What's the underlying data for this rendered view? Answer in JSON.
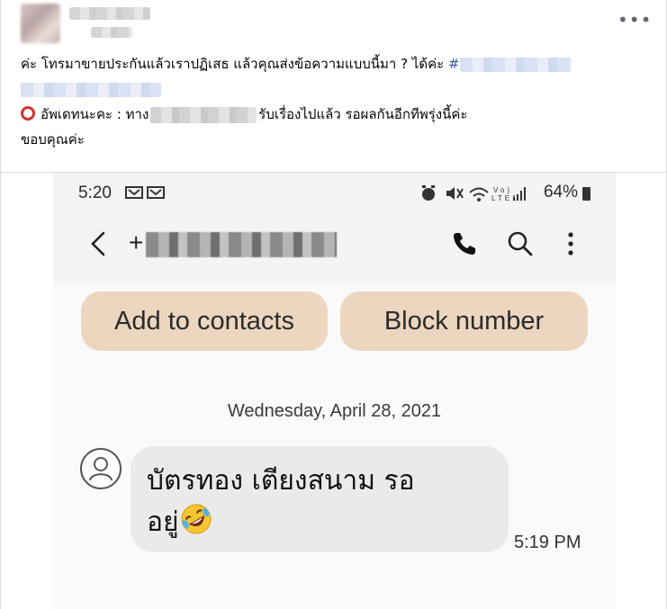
{
  "post": {
    "line1_text": "ค่ะ โทรมาขายประกันแล้วเราปฏิเสธ แล้วคุณส่งข้อความแบบนี้มา ? ได้ค่ะ ",
    "hashtag_prefix": "#",
    "line3_a": "อัพเดทนะคะ : ทาง",
    "line3_b": "รับเรื่องไปแล้ว รอผลกันอีกทีพรุ่งนี้ค่ะ",
    "line4": "ขอบคุณค่ะ",
    "more_label": "•••"
  },
  "phone": {
    "status": {
      "time": "5:20",
      "battery": "64%"
    },
    "contact": {
      "number_prefix": "+"
    },
    "buttons": {
      "add_contacts": "Add to contacts",
      "block_number": "Block number"
    },
    "date_separator": "Wednesday, April 28, 2021",
    "message": {
      "text_line1": "บัตรทอง เตียงสนาม รอ",
      "text_line2": "อยู่",
      "emoji": "rolling-on-floor-laughing-emoji",
      "time": "5:19 PM"
    }
  },
  "colors": {
    "button_bg": "#ecd6bf",
    "bubble_bg": "#eaeaea",
    "hashtag": "#385898",
    "circle_emoji": "#d1332d"
  }
}
